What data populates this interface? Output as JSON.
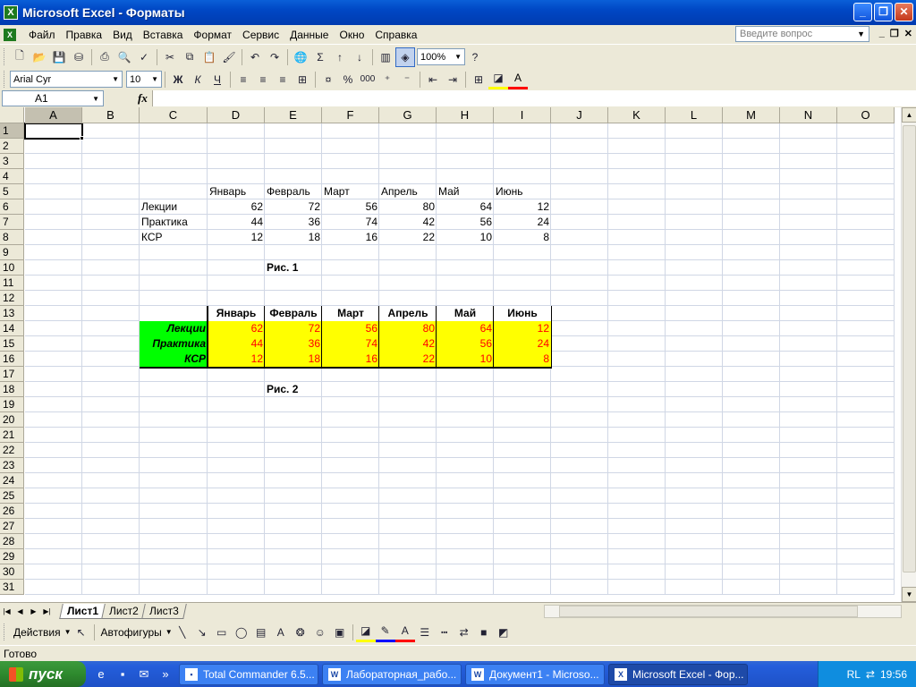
{
  "window": {
    "title": "Microsoft Excel - Форматы",
    "icon": "excel-icon"
  },
  "menu": [
    "Файл",
    "Правка",
    "Вид",
    "Вставка",
    "Формат",
    "Сервис",
    "Данные",
    "Окно",
    "Справка"
  ],
  "help": {
    "placeholder": "Введите вопрос"
  },
  "toolbar": {
    "zoom": "100%",
    "font": "Arial Cyr",
    "font_size": "10",
    "bold": "Ж",
    "italic": "К",
    "underline": "Ч",
    "percent": "%",
    "thousands": "000"
  },
  "formula": {
    "cell_ref": "A1",
    "fx": "fx",
    "content": ""
  },
  "columns": [
    "A",
    "B",
    "C",
    "D",
    "E",
    "F",
    "G",
    "H",
    "I",
    "J",
    "K",
    "L",
    "M",
    "N",
    "O"
  ],
  "rows": [
    "1",
    "2",
    "3",
    "4",
    "5",
    "6",
    "7",
    "8",
    "9",
    "10",
    "11",
    "12",
    "13",
    "14",
    "15",
    "16",
    "17",
    "18",
    "19",
    "20",
    "21",
    "22",
    "23",
    "24",
    "25",
    "26",
    "27",
    "28",
    "29",
    "30",
    "31"
  ],
  "table1": {
    "months": [
      "Январь",
      "Февраль",
      "Март",
      "Апрель",
      "Май",
      "Июнь"
    ],
    "rows": [
      {
        "label": "Лекции",
        "values": [
          62,
          72,
          56,
          80,
          64,
          12
        ]
      },
      {
        "label": "Практика",
        "values": [
          44,
          36,
          74,
          42,
          56,
          24
        ]
      },
      {
        "label": "КСР",
        "values": [
          12,
          18,
          16,
          22,
          10,
          8
        ]
      }
    ],
    "caption": "Рис. 1"
  },
  "table2": {
    "months": [
      "Январь",
      "Февраль",
      "Март",
      "Апрель",
      "Май",
      "Июнь"
    ],
    "rows": [
      {
        "label": "Лекции",
        "values": [
          62,
          72,
          56,
          80,
          64,
          12
        ]
      },
      {
        "label": "Практика",
        "values": [
          44,
          36,
          74,
          42,
          56,
          24
        ]
      },
      {
        "label": "КСР",
        "values": [
          12,
          18,
          16,
          22,
          10,
          8
        ]
      }
    ],
    "caption": "Рис. 2",
    "colors": {
      "label_bg": "#00ff00",
      "data_bg": "#ffff00",
      "data_text": "#ff0000",
      "label_text": "#000000"
    }
  },
  "sheets": [
    {
      "name": "Лист1",
      "active": true
    },
    {
      "name": "Лист2",
      "active": false
    },
    {
      "name": "Лист3",
      "active": false
    }
  ],
  "drawing": {
    "actions": "Действия",
    "autoshapes": "Автофигуры"
  },
  "status": "Готово",
  "taskbar": {
    "start": "пуск",
    "items": [
      {
        "label": "Total Commander 6.5...",
        "active": false
      },
      {
        "label": "Лабораторная_рабо...",
        "active": false
      },
      {
        "label": "Документ1 - Microso...",
        "active": false
      },
      {
        "label": "Microsoft Excel - Фор...",
        "active": true
      }
    ],
    "lang": "RL",
    "clock": "19:56"
  }
}
